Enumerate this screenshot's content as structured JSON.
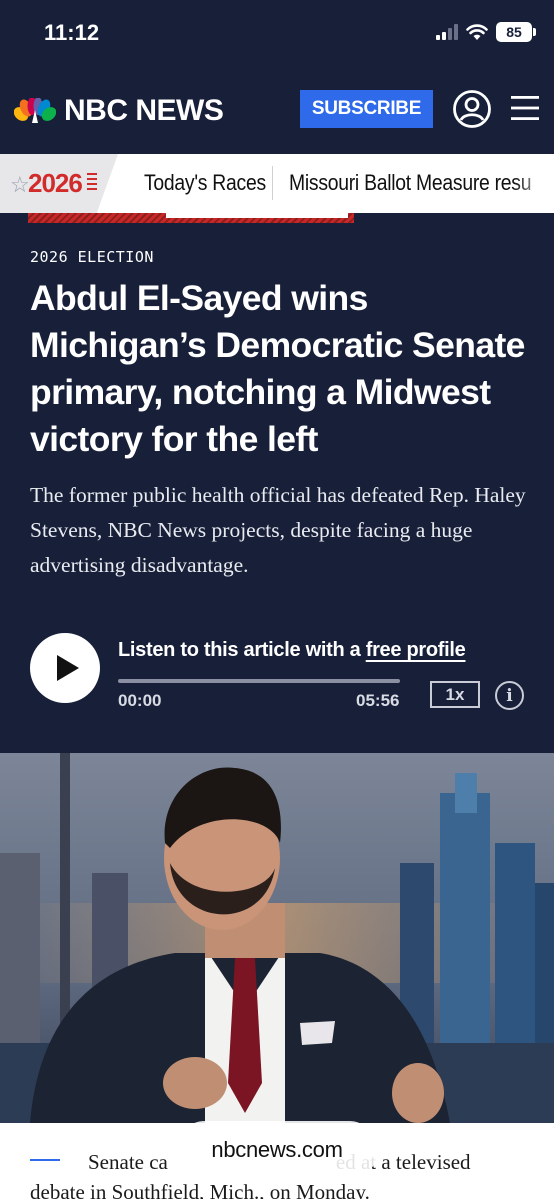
{
  "status_bar": {
    "time": "11:12",
    "battery": "85"
  },
  "header": {
    "logo_text": "NBC NEWS",
    "subscribe_label": "SUBSCRIBE",
    "icons": [
      "peacock-logo-icon",
      "account-icon",
      "menu-icon"
    ],
    "colors": {
      "background": "#182039",
      "subscribe": "#2f6aeb"
    }
  },
  "election_bar": {
    "badge_year": "2026",
    "links": [
      "Today's Races",
      "Missouri Ballot Measure resu"
    ]
  },
  "article": {
    "eyebrow": "2026 ELECTION",
    "headline": "Abdul El-Sayed wins Michigan’s Democratic Senate primary, notching a Midwest victory for the left",
    "dek": "The former public health official has defeated Rep. Haley Stevens, NBC News projects, despite facing a huge advertising disadvantage."
  },
  "audio_player": {
    "listen_prefix": "Listen to this article with a ",
    "listen_link": "free profile",
    "time_current": "00:00",
    "time_total": "05:56",
    "speed": "1x",
    "info": "i",
    "progress_fraction": 0.0
  },
  "caption": {
    "text_start": "Senate ca",
    "text_end": "ed at a televised debate in Southfield, Mich., on Monday."
  },
  "browser": {
    "url": "nbcnews.com"
  }
}
